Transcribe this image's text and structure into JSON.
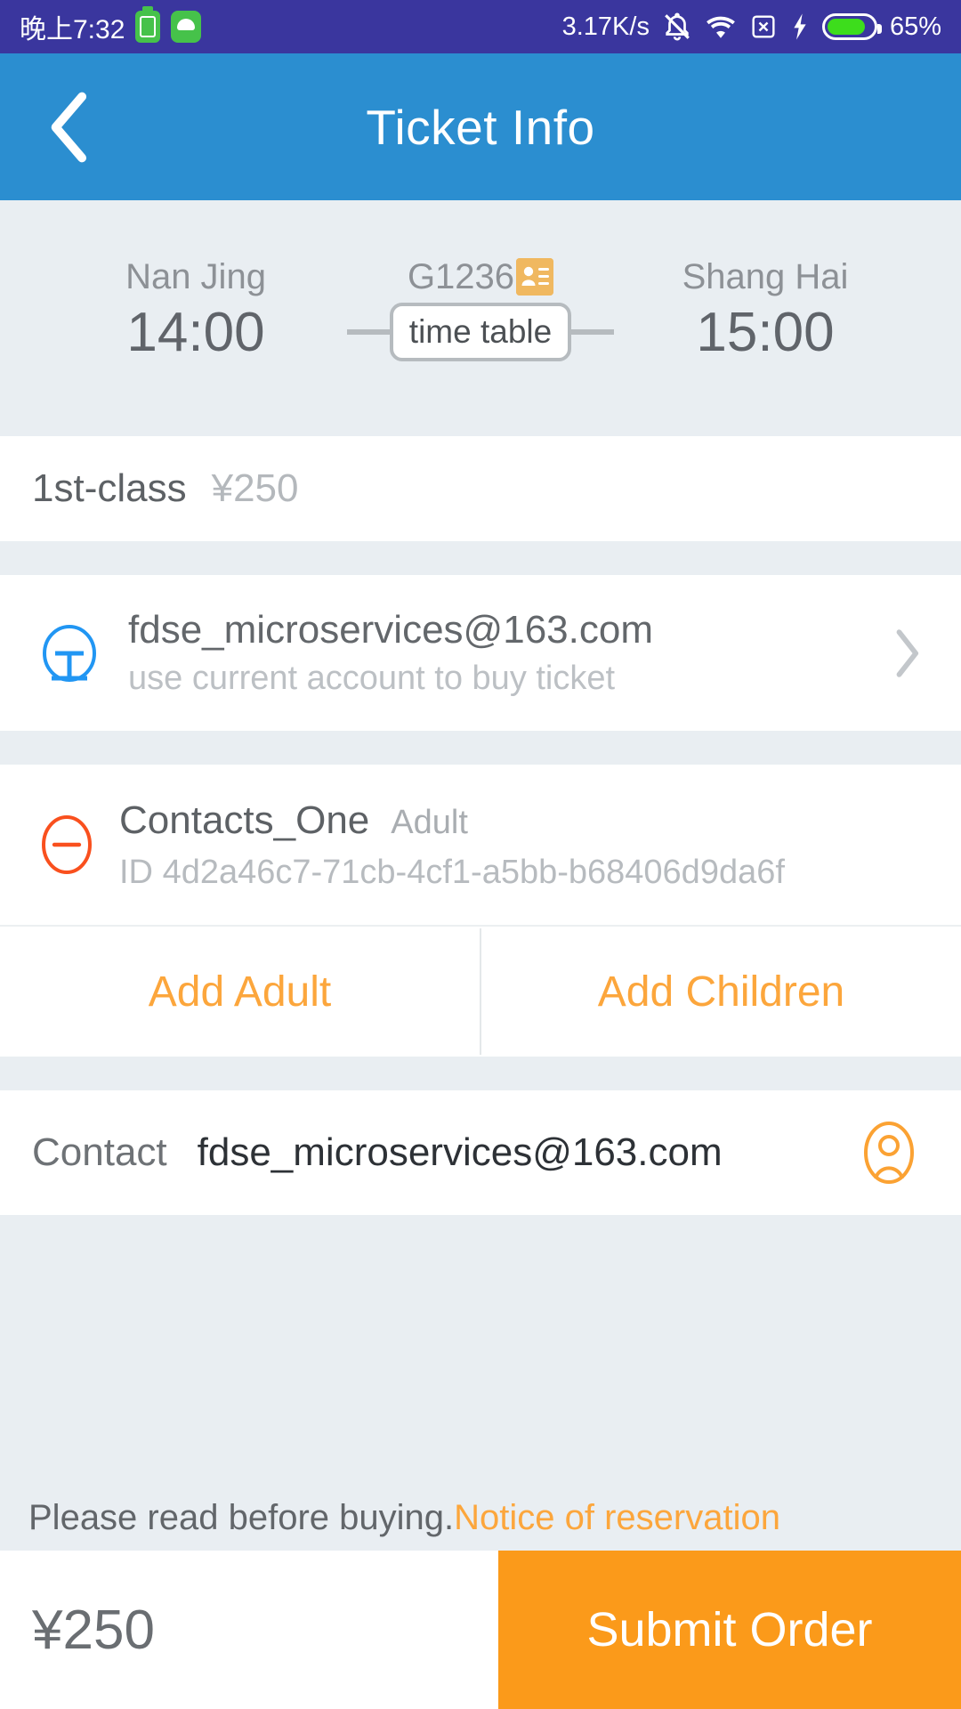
{
  "status_bar": {
    "time": "晚上7:32",
    "battery_saver_icon": "battery-chip-icon",
    "android_icon": "android-robot-icon",
    "network_speed": "3.17K/s",
    "mute_icon": "bell-muted-icon",
    "wifi_icon": "wifi-icon",
    "sim_icon": "sim-x-icon",
    "charging_icon": "charging-bolt-icon",
    "battery_icon": "battery-icon",
    "battery_percent": "65%"
  },
  "header": {
    "back_icon": "back-chevron-icon",
    "title": "Ticket Info",
    "background_color": "#2b8ed0"
  },
  "trip": {
    "from_station": "Nan Jing",
    "to_station": "Shang Hai",
    "train_number": "G1236",
    "train_card_icon": "contact-card-icon",
    "depart_time": "14:00",
    "arrive_time": "15:00",
    "timetable_label": "time table"
  },
  "seat": {
    "class_label": "1st-class",
    "price": "¥250"
  },
  "account": {
    "icon": "account-circle-icon",
    "email": "fdse_microservices@163.com",
    "subtitle": "use current account to buy ticket",
    "chevron_icon": "chevron-right-icon"
  },
  "passengers": [
    {
      "remove_icon": "minus-circle-icon",
      "name": "Contacts_One",
      "type": "Adult",
      "id_label": "ID",
      "id_value": "4d2a46c7-71cb-4cf1-a5bb-b68406d9da6f"
    }
  ],
  "add_buttons": {
    "add_adult": "Add Adult",
    "add_children": "Add Children"
  },
  "contact": {
    "label": "Contact",
    "value": "fdse_microservices@163.com",
    "person_icon": "person-circle-icon"
  },
  "notice": {
    "static_text": "Please read before buying.",
    "link_text": "Notice of reservation"
  },
  "bottom_bar": {
    "total_price": "¥250",
    "submit_label": "Submit Order",
    "submit_color": "#fb9a1a"
  },
  "colors": {
    "accent_orange": "#fca63c",
    "header_blue": "#2b8ed0",
    "panel_gray": "#e9eef2",
    "status_bar_blue": "#3a369e"
  }
}
